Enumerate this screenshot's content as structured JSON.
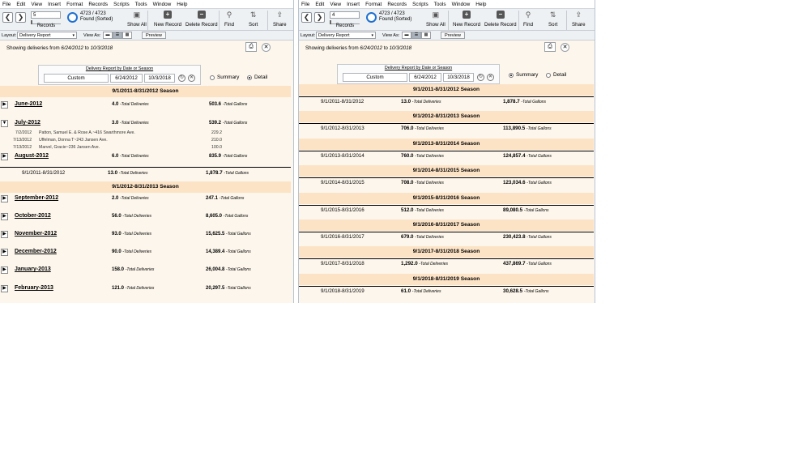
{
  "menu": [
    "File",
    "Edit",
    "View",
    "Insert",
    "Format",
    "Records",
    "Scripts",
    "Tools",
    "Window",
    "Help"
  ],
  "win1": {
    "record_number": "5",
    "records_label": "Records",
    "found_count": "4723 / 4723",
    "found_state": "Found (Sorted)",
    "toolbar": {
      "show_all": "Show All",
      "new_record": "New Record",
      "delete_record": "Delete Record",
      "find": "Find",
      "sort": "Sort",
      "share": "Share"
    },
    "layout_label": "Layout:",
    "layout_value": "Delivery Report",
    "view_as_label": "View As:",
    "preview_label": "Preview",
    "showing_prefix": "Showing deliveries from",
    "showing_from": "6/24/2012",
    "showing_to_word": "to",
    "showing_to": "10/3/2018",
    "panel_title": "Delivery Report by Date or Season",
    "panel_mode": "Custom",
    "panel_start": "6/24/2012",
    "panel_end": "10/3/2018",
    "radio_summary": "Summary",
    "radio_detail": "Detail",
    "total_deliveries_label": "-Total Deliveries",
    "total_gallons_label": "-Total Gallons",
    "season_2011": "9/1/2011-8/31/2012 Season",
    "months_2011": [
      {
        "name": "June-2012",
        "deliveries": "4.0",
        "gallons": "503.6",
        "expanded": false
      },
      {
        "name": "July-2012",
        "deliveries": "3.0",
        "gallons": "539.2",
        "expanded": true
      },
      {
        "name": "August-2012",
        "deliveries": "6.0",
        "gallons": "835.9",
        "expanded": false
      }
    ],
    "july_details": [
      {
        "date": "7/2/2012",
        "customer": "Patton, Samuel E. & Rose A.~416 Swarthmore Ave.",
        "gallons": "229.2"
      },
      {
        "date": "7/13/2012",
        "customer": "Uffelman, Donna T~243 Jansen Ave.",
        "gallons": "210.0"
      },
      {
        "date": "7/13/2012",
        "customer": "Marvel, Gracie~236 Jansen Ave.",
        "gallons": "100.0"
      }
    ],
    "season_2011_total": {
      "range": "9/1/2011-8/31/2012",
      "deliveries": "13.0",
      "gallons": "1,878.7"
    },
    "season_2012": "9/1/2012-8/31/2013 Season",
    "months_2012": [
      {
        "name": "September-2012",
        "deliveries": "2.0",
        "gallons": "247.1"
      },
      {
        "name": "October-2012",
        "deliveries": "56.0",
        "gallons": "8,605.0"
      },
      {
        "name": "November-2012",
        "deliveries": "93.0",
        "gallons": "15,625.5"
      },
      {
        "name": "December-2012",
        "deliveries": "90.0",
        "gallons": "14,389.4"
      },
      {
        "name": "January-2013",
        "deliveries": "158.0",
        "gallons": "26,004.8"
      },
      {
        "name": "February-2013",
        "deliveries": "121.0",
        "gallons": "20,297.5"
      }
    ]
  },
  "win2": {
    "record_number": "4",
    "records_label": "Records",
    "found_count": "4723 / 4723",
    "found_state": "Found (Sorted)",
    "toolbar": {
      "show_all": "Show All",
      "new_record": "New Record",
      "delete_record": "Delete Record",
      "find": "Find",
      "sort": "Sort",
      "share": "Share"
    },
    "layout_label": "Layout:",
    "layout_value": "Delivery Report",
    "view_as_label": "View As:",
    "preview_label": "Preview",
    "showing_prefix": "Showing deliveries from",
    "showing_from": "6/24/2012",
    "showing_to_word": "to",
    "showing_to": "10/3/2018",
    "panel_title": "Delivery Report by Date or Season",
    "panel_mode": "Custom",
    "panel_start": "6/24/2012",
    "panel_end": "10/3/2018",
    "radio_summary": "Summary",
    "radio_detail": "Detail",
    "total_deliveries_label": "-Total Deliveries",
    "total_gallons_label": "-Total Gallons",
    "seasons": [
      {
        "title": "9/1/2011-8/31/2012 Season",
        "range": "9/1/2011-8/31/2012",
        "deliveries": "13.0",
        "gallons": "1,878.7"
      },
      {
        "title": "9/1/2012-8/31/2013 Season",
        "range": "9/1/2012-8/31/2013",
        "deliveries": "706.0",
        "gallons": "113,890.5"
      },
      {
        "title": "9/1/2013-8/31/2014 Season",
        "range": "9/1/2013-8/31/2014",
        "deliveries": "760.0",
        "gallons": "124,857.4"
      },
      {
        "title": "9/1/2014-8/31/2015 Season",
        "range": "9/1/2014-8/31/2015",
        "deliveries": "708.0",
        "gallons": "123,034.6"
      },
      {
        "title": "9/1/2015-8/31/2016 Season",
        "range": "9/1/2015-8/31/2016",
        "deliveries": "512.0",
        "gallons": "89,080.5"
      },
      {
        "title": "9/1/2016-8/31/2017 Season",
        "range": "9/1/2016-8/31/2017",
        "deliveries": "679.0",
        "gallons": "230,423.8"
      },
      {
        "title": "9/1/2017-8/31/2018 Season",
        "range": "9/1/2017-8/31/2018",
        "deliveries": "1,292.0",
        "gallons": "437,869.7"
      },
      {
        "title": "9/1/2018-8/31/2019 Season",
        "range": "9/1/2018-8/31/2019",
        "deliveries": "61.0",
        "gallons": "30,628.5"
      }
    ]
  }
}
